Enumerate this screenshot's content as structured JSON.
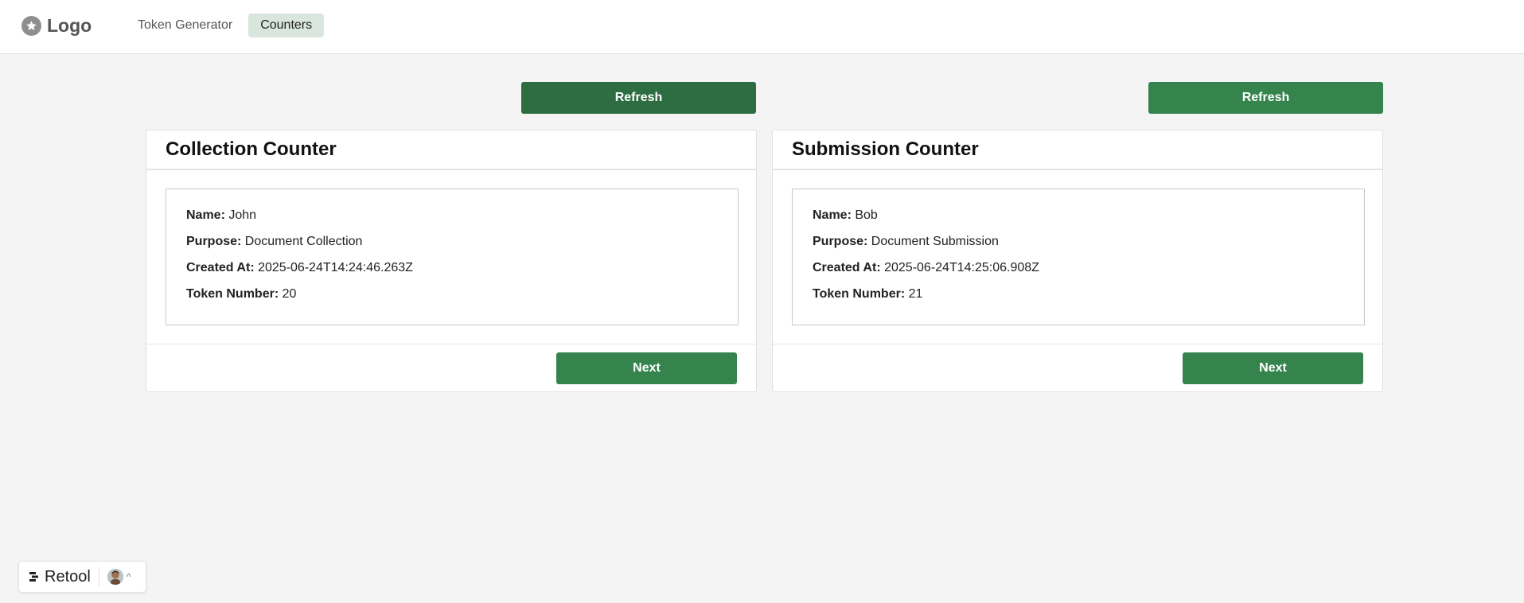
{
  "header": {
    "logo_text": "Logo",
    "tabs": [
      {
        "label": "Token Generator",
        "active": false
      },
      {
        "label": "Counters",
        "active": true
      }
    ]
  },
  "colors": {
    "primary_green": "#35844d",
    "active_tab_bg": "#d8e6dd"
  },
  "collection": {
    "refresh_label": "Refresh",
    "title": "Collection Counter",
    "name_label": "Name:",
    "name": "John",
    "purpose_label": "Purpose:",
    "purpose": "Document Collection",
    "created_label": "Created At:",
    "created_at": "2025-06-24T14:24:46.263Z",
    "token_label": "Token Number:",
    "token_number": "20",
    "next_label": "Next"
  },
  "submission": {
    "refresh_label": "Refresh",
    "title": "Submission Counter",
    "name_label": "Name:",
    "name": "Bob",
    "purpose_label": "Purpose:",
    "purpose": "Document Submission",
    "created_label": "Created At:",
    "created_at": "2025-06-24T14:25:06.908Z",
    "token_label": "Token Number:",
    "token_number": "21",
    "next_label": "Next"
  },
  "retool_badge": {
    "label": "Retool",
    "icons": [
      "retool-logo-icon",
      "user-avatar",
      "chevron-up-icon"
    ]
  }
}
